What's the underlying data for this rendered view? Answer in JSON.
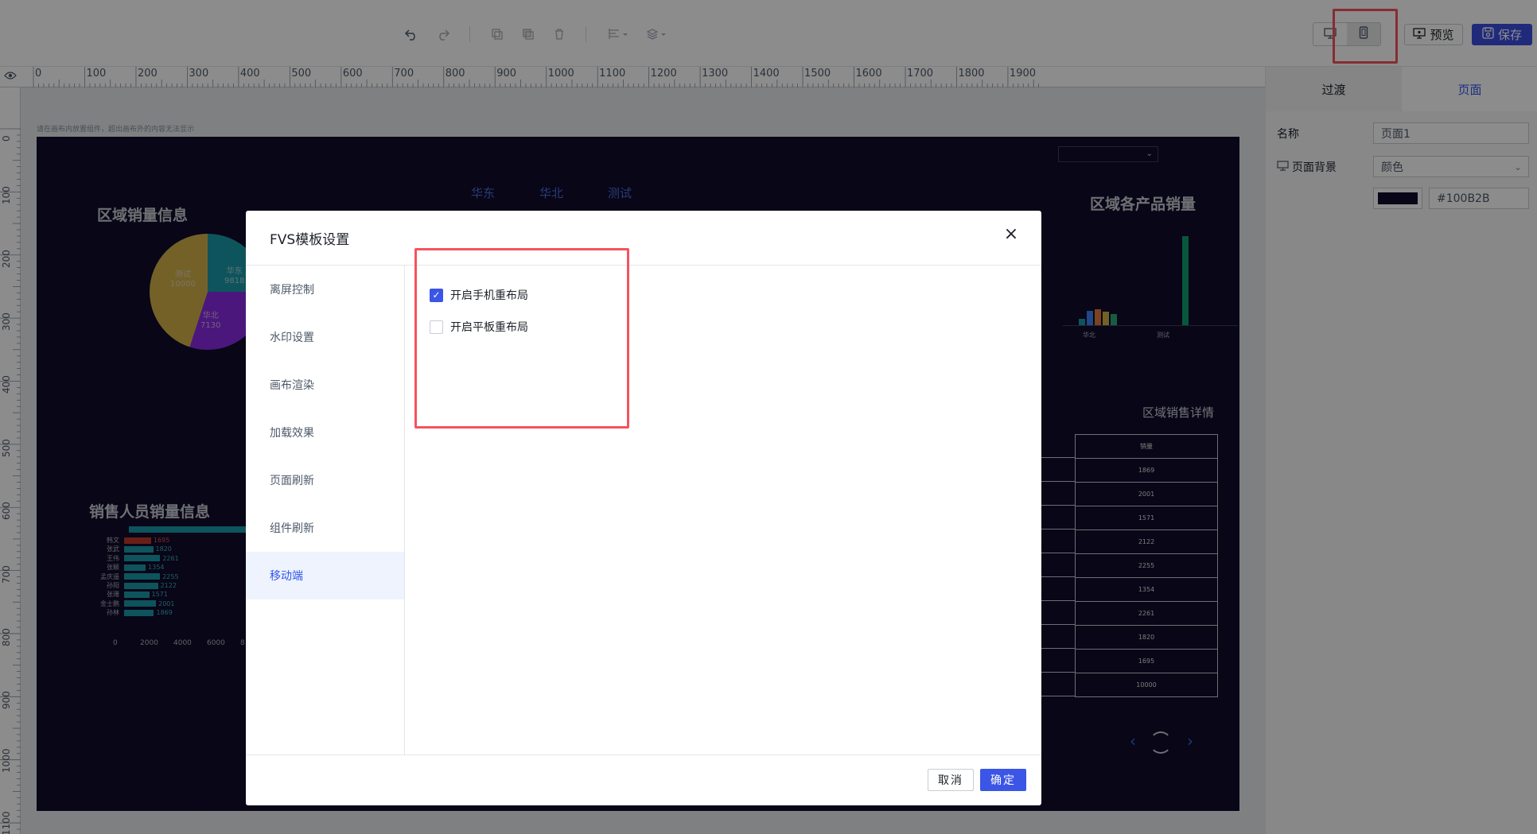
{
  "toolbar": {
    "undo_icon": "undo-icon",
    "redo_icon": "redo-icon",
    "copy_icon": "copy-icon",
    "paste_icon": "paste-icon",
    "delete_icon": "trash-icon",
    "align_icon": "align-icon",
    "layer_icon": "layers-icon",
    "pc_icon": "desktop-icon",
    "mobile_icon": "mobile-icon",
    "preview_label": "预览",
    "save_label": "保存"
  },
  "ruler": {
    "top_labels": [
      "0",
      "100",
      "200",
      "300",
      "400",
      "500",
      "600",
      "700",
      "800",
      "900",
      "1000",
      "1100",
      "1200",
      "1300",
      "1400",
      "1500",
      "1600",
      "1700",
      "1800",
      "1900"
    ],
    "left_labels": [
      "0",
      "100",
      "200",
      "300",
      "400",
      "500",
      "600",
      "700",
      "800",
      "900",
      "1000",
      "1100"
    ]
  },
  "canvas": {
    "hint": "请在画布内放置组件，超出画布外的内容无法显示",
    "tabs": [
      "华东",
      "华北",
      "测试"
    ],
    "region_sales_title": "区域销量信息",
    "product_sales_title": "区域各产品销量",
    "salesperson_title": "销售人员销量信息",
    "region_detail_title": "区域销售详情",
    "pie_labels": [
      {
        "name": "测试",
        "value": "10000"
      },
      {
        "name": "华东",
        "value": "9818"
      },
      {
        "name": "华北",
        "value": "7130"
      }
    ],
    "product_xlabels": [
      "华北",
      "测试"
    ],
    "salespeople": [
      {
        "name": "韩文",
        "value": 1695
      },
      {
        "name": "张武",
        "value": 1820
      },
      {
        "name": "王伟",
        "value": 2261
      },
      {
        "name": "张颖",
        "value": 1354
      },
      {
        "name": "孟庆遥",
        "value": 2255
      },
      {
        "name": "孙阳",
        "value": 2122
      },
      {
        "name": "张珊",
        "value": 1571
      },
      {
        "name": "金士鹏",
        "value": 2001
      },
      {
        "name": "孙林",
        "value": 1869
      }
    ],
    "x_ticks": [
      "0",
      "2000",
      "4000",
      "6000",
      "8"
    ],
    "table_header": "销量",
    "table_values": [
      "1869",
      "2001",
      "1571",
      "2122",
      "2255",
      "1354",
      "2261",
      "1820",
      "1695",
      "10000"
    ]
  },
  "right_panel": {
    "tab_transition": "过渡",
    "tab_page": "页面",
    "name_label": "名称",
    "name_value": "页面1",
    "bg_label": "页面背景",
    "bg_type": "颜色",
    "bg_color": "#100B2B"
  },
  "modal": {
    "title": "FVS模板设置",
    "menu": [
      "离屏控制",
      "水印设置",
      "画布渲染",
      "加载效果",
      "页面刷新",
      "组件刷新",
      "移动端"
    ],
    "active_menu": "移动端",
    "options": [
      {
        "label": "开启手机重布局",
        "checked": true
      },
      {
        "label": "开启平板重布局",
        "checked": false
      }
    ],
    "cancel_label": "取消",
    "ok_label": "确定"
  },
  "colors": {
    "accent": "#3B55E6",
    "highlight": "#F5535E",
    "canvas_bg": "#100B2B"
  }
}
